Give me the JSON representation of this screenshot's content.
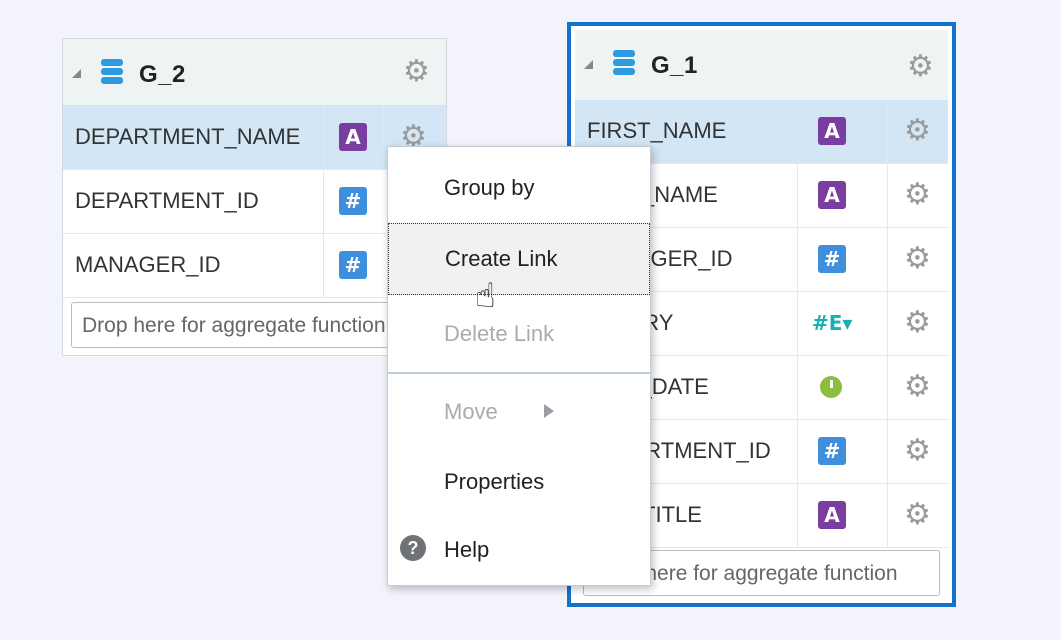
{
  "g2": {
    "title": "G_2",
    "rows": [
      {
        "name": "DEPARTMENT_NAME",
        "type": "A"
      },
      {
        "name": "DEPARTMENT_ID",
        "type": "#"
      },
      {
        "name": "MANAGER_ID",
        "type": "#"
      }
    ],
    "drop_placeholder": "Drop here for aggregate function"
  },
  "g1": {
    "title": "G_1",
    "rows": [
      {
        "name": "FIRST_NAME",
        "type": "A"
      },
      {
        "name": "LAST_NAME",
        "type": "A"
      },
      {
        "name": "MANAGER_ID",
        "type": "#"
      },
      {
        "name": "SALARY",
        "type": "#E▾"
      },
      {
        "name": "HIRE_DATE",
        "type": "timer"
      },
      {
        "name": "DEPARTMENT_ID",
        "type": "#"
      },
      {
        "name": "JOB_TITLE",
        "type": "A"
      }
    ],
    "drop_placeholder": "Drop here for aggregate function"
  },
  "menu": {
    "group_by": "Group by",
    "create_link": "Create Link",
    "delete_link": "Delete Link",
    "move": "Move",
    "properties": "Properties",
    "help": "Help"
  },
  "icons": {
    "gear": "⚙",
    "help": "?"
  },
  "colors": {
    "accent": "#1472cf",
    "selected_row": "#d2e6f5",
    "type_text": "#7a3ea1",
    "type_number": "#3f8fdc"
  }
}
